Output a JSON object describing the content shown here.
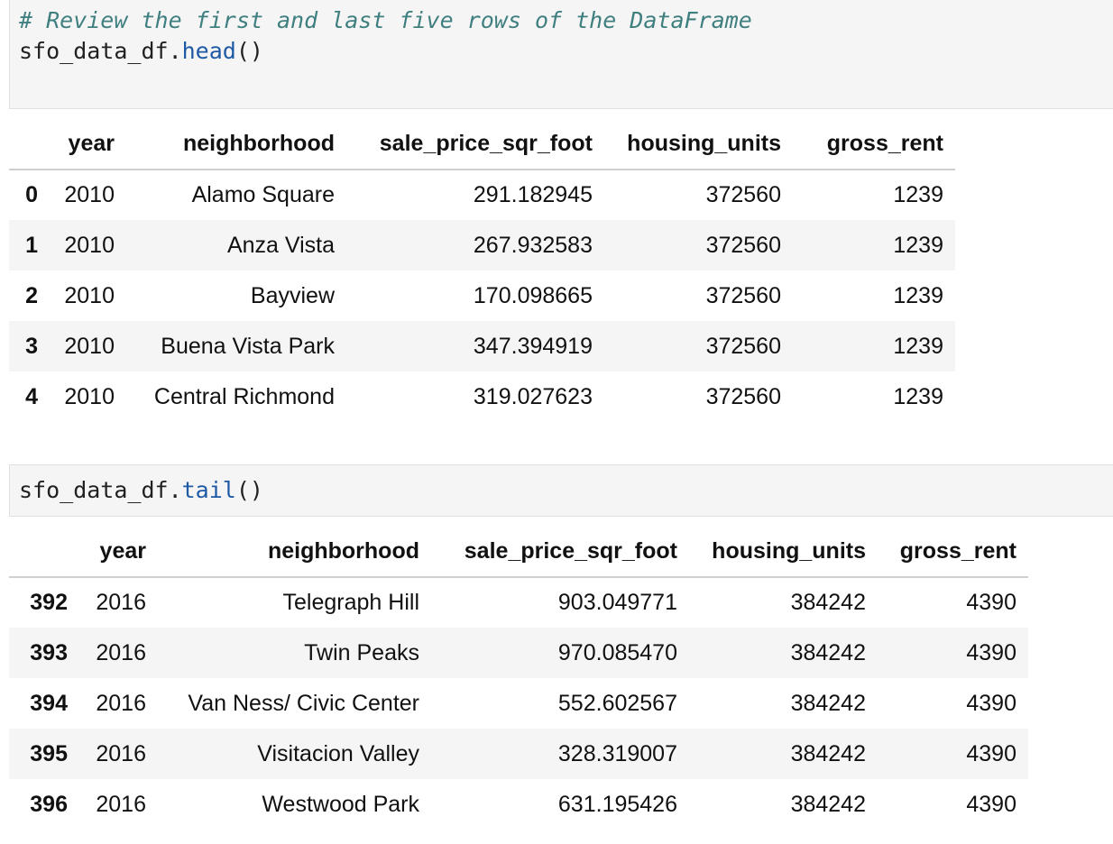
{
  "cells": {
    "head": {
      "comment": "# Review the first and last five rows of the DataFrame",
      "object": "sfo_data_df.",
      "method": "head",
      "args": "()"
    },
    "tail": {
      "object": "sfo_data_df.",
      "method": "tail",
      "args": "()"
    }
  },
  "columns": [
    "year",
    "neighborhood",
    "sale_price_sqr_foot",
    "housing_units",
    "gross_rent"
  ],
  "head_rows": [
    {
      "index": "0",
      "year": "2010",
      "neighborhood": "Alamo Square",
      "sale_price_sqr_foot": "291.182945",
      "housing_units": "372560",
      "gross_rent": "1239"
    },
    {
      "index": "1",
      "year": "2010",
      "neighborhood": "Anza Vista",
      "sale_price_sqr_foot": "267.932583",
      "housing_units": "372560",
      "gross_rent": "1239"
    },
    {
      "index": "2",
      "year": "2010",
      "neighborhood": "Bayview",
      "sale_price_sqr_foot": "170.098665",
      "housing_units": "372560",
      "gross_rent": "1239"
    },
    {
      "index": "3",
      "year": "2010",
      "neighborhood": "Buena Vista Park",
      "sale_price_sqr_foot": "347.394919",
      "housing_units": "372560",
      "gross_rent": "1239"
    },
    {
      "index": "4",
      "year": "2010",
      "neighborhood": "Central Richmond",
      "sale_price_sqr_foot": "319.027623",
      "housing_units": "372560",
      "gross_rent": "1239"
    }
  ],
  "tail_rows": [
    {
      "index": "392",
      "year": "2016",
      "neighborhood": "Telegraph Hill",
      "sale_price_sqr_foot": "903.049771",
      "housing_units": "384242",
      "gross_rent": "4390"
    },
    {
      "index": "393",
      "year": "2016",
      "neighborhood": "Twin Peaks",
      "sale_price_sqr_foot": "970.085470",
      "housing_units": "384242",
      "gross_rent": "4390"
    },
    {
      "index": "394",
      "year": "2016",
      "neighborhood": "Van Ness/ Civic Center",
      "sale_price_sqr_foot": "552.602567",
      "housing_units": "384242",
      "gross_rent": "4390"
    },
    {
      "index": "395",
      "year": "2016",
      "neighborhood": "Visitacion Valley",
      "sale_price_sqr_foot": "328.319007",
      "housing_units": "384242",
      "gross_rent": "4390"
    },
    {
      "index": "396",
      "year": "2016",
      "neighborhood": "Westwood Park",
      "sale_price_sqr_foot": "631.195426",
      "housing_units": "384242",
      "gross_rent": "4390"
    }
  ],
  "colors": {
    "comment": "#3f7f7f",
    "method": "#1f5aa6",
    "cell_background": "#f5f5f5",
    "stripe": "#f5f5f5"
  }
}
